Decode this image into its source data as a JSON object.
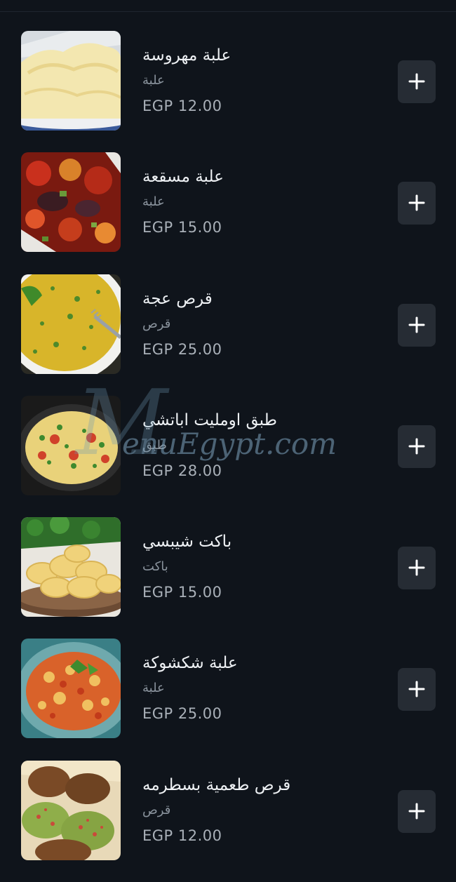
{
  "menu": {
    "items": [
      {
        "name": "علبة مهروسة",
        "category": "علبة",
        "price": "EGP 12.00",
        "image": "mashed-potato-photo"
      },
      {
        "name": "علبة مسقعة",
        "category": "علبة",
        "price": "EGP 15.00",
        "image": "moussaka-photo"
      },
      {
        "name": "قرص عجة",
        "category": "قرص",
        "price": "EGP 25.00",
        "image": "eggah-photo"
      },
      {
        "name": "طبق اومليت اباتشي",
        "category": "طبق",
        "price": "EGP 28.00",
        "image": "apache-omelette-photo"
      },
      {
        "name": "باكت شيبسي",
        "category": "باكت",
        "price": "EGP 15.00",
        "image": "chips-photo"
      },
      {
        "name": "علبة شكشوكة",
        "category": "علبة",
        "price": "EGP 25.00",
        "image": "shakshuka-photo"
      },
      {
        "name": "قرص طعمية بسطرمه",
        "category": "قرص",
        "price": "EGP 12.00",
        "image": "falafel-pastrami-photo"
      }
    ],
    "add_icon": "plus-icon"
  },
  "watermark": {
    "initial": "M",
    "text": "enuEgypt.com"
  },
  "colors": {
    "background": "#0f141b",
    "button": "#262c34",
    "title": "#eef1f4",
    "muted": "#8a939d"
  }
}
